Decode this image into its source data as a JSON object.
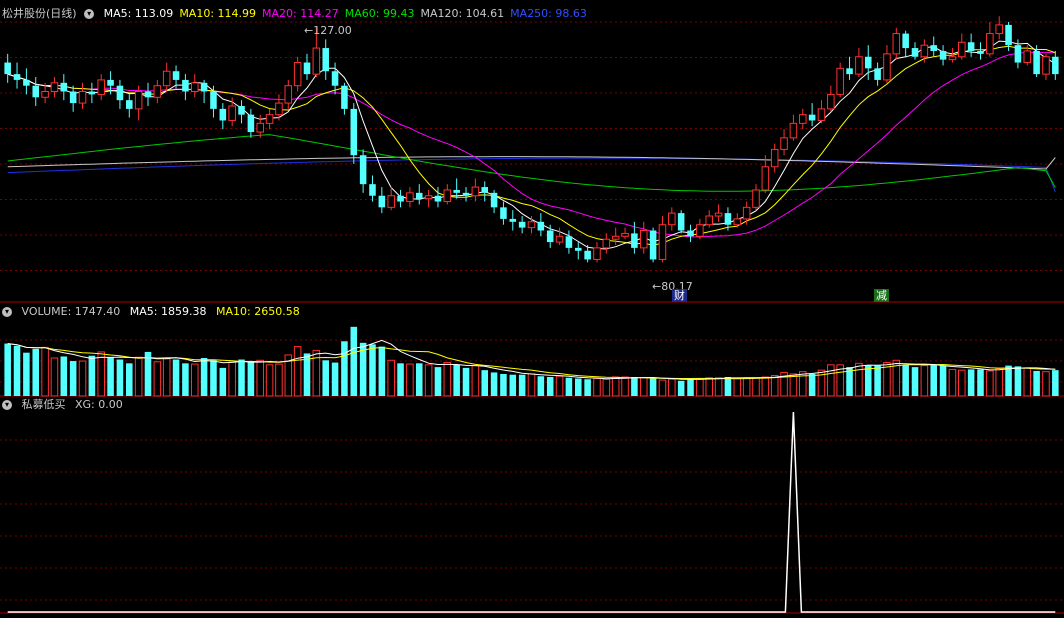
{
  "price_panel": {
    "title": "松井股份(日线)",
    "indicators": [
      {
        "label": "MA5: 113.09",
        "color": "#ffffff"
      },
      {
        "label": "MA10: 114.99",
        "color": "#ffff00"
      },
      {
        "label": "MA20: 114.27",
        "color": "#ff00ff"
      },
      {
        "label": "MA60: 99.43",
        "color": "#00e000"
      },
      {
        "label": "MA120: 104.61",
        "color": "#c8c8c8"
      },
      {
        "label": "MA250: 98.63",
        "color": "#3050ff"
      }
    ],
    "high_label": "127.00",
    "low_label": "80.17",
    "marker_cai": "财",
    "marker_jian": "减"
  },
  "volume_panel": {
    "title": "VOLUME: 1747.40",
    "ma5": "MA5: 1859.38",
    "ma10": "MA10: 2650.58",
    "ma5_color": "#ffffff",
    "ma10_color": "#ffff00"
  },
  "indicator_panel": {
    "title": "私募低买",
    "xg": "XG: 0.00"
  },
  "colors": {
    "up": "#ff3030",
    "down": "#54ffff",
    "grid": "#7a0000",
    "divider": "#b00000"
  },
  "chart_data": [
    {
      "type": "candlestick",
      "title": "松井股份(日线)",
      "ylim": [
        80,
        128
      ],
      "candles": [
        [
          121,
          119,
          122.5,
          117.5
        ],
        [
          119,
          118,
          121,
          116.5
        ],
        [
          118,
          117,
          120,
          115.5
        ],
        [
          117,
          115,
          118.5,
          113.5
        ],
        [
          115,
          116,
          117.5,
          114
        ],
        [
          116,
          117.5,
          118.5,
          115
        ],
        [
          117.5,
          116,
          119,
          114.5
        ],
        [
          116,
          114,
          117,
          112.5
        ],
        [
          114,
          116,
          117.5,
          113
        ],
        [
          116,
          115.5,
          117.5,
          114
        ],
        [
          115.5,
          118,
          119,
          114.5
        ],
        [
          118,
          117,
          119.5,
          115.5
        ],
        [
          117,
          114.5,
          118,
          113
        ],
        [
          114.5,
          113,
          115.5,
          111.5
        ],
        [
          113,
          116,
          117,
          111
        ],
        [
          116,
          115,
          117.5,
          113.5
        ],
        [
          115,
          117,
          118,
          114
        ],
        [
          117,
          119.5,
          121,
          116
        ],
        [
          119.5,
          118,
          120.5,
          116.5
        ],
        [
          118,
          116,
          119,
          114.5
        ],
        [
          116,
          117.5,
          119,
          115
        ],
        [
          117.5,
          116,
          118,
          114
        ],
        [
          116,
          113,
          117,
          111.5
        ],
        [
          113,
          111,
          114,
          109.5
        ],
        [
          111,
          113.5,
          115,
          110
        ],
        [
          113.5,
          112,
          114.5,
          110.5
        ],
        [
          112,
          109,
          113,
          108
        ],
        [
          109,
          110.5,
          112,
          108
        ],
        [
          110.5,
          112,
          113,
          109.5
        ],
        [
          112,
          114,
          115.5,
          111
        ],
        [
          114,
          117,
          118,
          113
        ],
        [
          117,
          121,
          122,
          116
        ],
        [
          121,
          119,
          122.5,
          118
        ],
        [
          119,
          123.5,
          127,
          118.5
        ],
        [
          123.5,
          119.5,
          125,
          118
        ],
        [
          119.5,
          117,
          121,
          115.5
        ],
        [
          117,
          113,
          117.5,
          112
        ],
        [
          113,
          105,
          114,
          103.5
        ],
        [
          105,
          100,
          106,
          98.5
        ],
        [
          100,
          98,
          101.5,
          97
        ],
        [
          98,
          96,
          99.5,
          95
        ],
        [
          96,
          98,
          99.5,
          95.5
        ],
        [
          98,
          97,
          99,
          96
        ],
        [
          97,
          98.5,
          99.5,
          96
        ],
        [
          98.5,
          97.5,
          100,
          96.5
        ],
        [
          97.5,
          98,
          99,
          96
        ],
        [
          98,
          97,
          99.5,
          96
        ],
        [
          97,
          99,
          100,
          96.5
        ],
        [
          99,
          98.5,
          101,
          97.5
        ],
        [
          98.5,
          98,
          99.5,
          97
        ],
        [
          98,
          99.5,
          101,
          97
        ],
        [
          99.5,
          98.5,
          100.5,
          97
        ],
        [
          98.5,
          96,
          99,
          95
        ],
        [
          96,
          94,
          97,
          93
        ],
        [
          94,
          93.5,
          95.5,
          92
        ],
        [
          93.5,
          92.5,
          94.5,
          91.5
        ],
        [
          92.5,
          93.5,
          94.5,
          91.5
        ],
        [
          93.5,
          92,
          95,
          91
        ],
        [
          92,
          90,
          93,
          89
        ],
        [
          90,
          91,
          92.5,
          89.5
        ],
        [
          91,
          89,
          92,
          88
        ],
        [
          89,
          88.5,
          90,
          87
        ],
        [
          88.5,
          87,
          89.5,
          86.5
        ],
        [
          87,
          89,
          90,
          86.5
        ],
        [
          89,
          90.5,
          91.5,
          88
        ],
        [
          90.5,
          91,
          92.5,
          89.5
        ],
        [
          91,
          91.5,
          92.5,
          90.5
        ],
        [
          91.5,
          89,
          93.5,
          88
        ],
        [
          89,
          92,
          93.5,
          88
        ],
        [
          92,
          87,
          92.5,
          86.5
        ],
        [
          87,
          93,
          94.5,
          86.5
        ],
        [
          93,
          95,
          96,
          92
        ],
        [
          95,
          92,
          95.5,
          91.5
        ],
        [
          92,
          91,
          93,
          90
        ],
        [
          91,
          93,
          94,
          90.5
        ],
        [
          93,
          94.5,
          95.5,
          92.5
        ],
        [
          94.5,
          95,
          96.5,
          93.5
        ],
        [
          95,
          93,
          96,
          92
        ],
        [
          93,
          94,
          95,
          92.5
        ],
        [
          94,
          96,
          97,
          93
        ],
        [
          96,
          99,
          100,
          95.5
        ],
        [
          99,
          103,
          105,
          98.5
        ],
        [
          103,
          106,
          107,
          102
        ],
        [
          106,
          108,
          109.5,
          105
        ],
        [
          108,
          110.5,
          112,
          107.5
        ],
        [
          110.5,
          112,
          113,
          109.5
        ],
        [
          112,
          111,
          114,
          110
        ],
        [
          111,
          113,
          114.5,
          110.5
        ],
        [
          113,
          115.5,
          117,
          112.5
        ],
        [
          115.5,
          120,
          121,
          115
        ],
        [
          120,
          119,
          122,
          118
        ],
        [
          119,
          122,
          123.5,
          118.5
        ],
        [
          122,
          120,
          124,
          118
        ],
        [
          120,
          118,
          121,
          117
        ],
        [
          118,
          122.5,
          124,
          117.5
        ],
        [
          122.5,
          126,
          127,
          121.5
        ],
        [
          126,
          123.5,
          126.5,
          122
        ],
        [
          123.5,
          122,
          124.5,
          121.5
        ],
        [
          122,
          124,
          125,
          121
        ],
        [
          124,
          123,
          125.5,
          122
        ],
        [
          123,
          121.5,
          124,
          120.5
        ],
        [
          121.5,
          122,
          123.5,
          121
        ],
        [
          122,
          124.5,
          126,
          121.5
        ],
        [
          124.5,
          123,
          126,
          122
        ],
        [
          123,
          122.5,
          124.5,
          121.5
        ],
        [
          122.5,
          126,
          128,
          122
        ],
        [
          126,
          127.5,
          129,
          125
        ],
        [
          127.5,
          124,
          128,
          123
        ],
        [
          124,
          121,
          125,
          120
        ],
        [
          121,
          123,
          124,
          120.5
        ],
        [
          123,
          119,
          124,
          118.5
        ],
        [
          119,
          122,
          122.5,
          118
        ],
        [
          122,
          119,
          123,
          118
        ]
      ],
      "ma5_last": 113.09,
      "ma10_last": 114.99,
      "ma20_last": 114.27,
      "ma60_last": 99.43,
      "ma120_last": 104.61,
      "ma250_last": 98.63
    },
    {
      "type": "bar",
      "title": "VOLUME",
      "ylim": [
        0,
        5000
      ],
      "values": [
        3450,
        3300,
        2850,
        3100,
        3200,
        2500,
        2600,
        2300,
        2300,
        2650,
        2900,
        2550,
        2400,
        2150,
        2550,
        2900,
        2250,
        2450,
        2400,
        2150,
        2100,
        2500,
        2350,
        1850,
        2250,
        2400,
        2300,
        2350,
        2050,
        2100,
        2700,
        3250,
        2800,
        3000,
        2350,
        2200,
        3600,
        4550,
        3500,
        3400,
        3250,
        2350,
        2150,
        2100,
        2150,
        2050,
        1900,
        2200,
        2050,
        1850,
        2000,
        1700,
        1550,
        1450,
        1400,
        1400,
        1450,
        1300,
        1250,
        1300,
        1200,
        1150,
        1100,
        1150,
        1100,
        1250,
        1250,
        1250,
        1200,
        1150,
        1050,
        1100,
        1000,
        1150,
        1150,
        1200,
        1200,
        1250,
        1150,
        1200,
        1200,
        1250,
        1350,
        1550,
        1450,
        1600,
        1450,
        1700,
        2050,
        2050,
        1900,
        2150,
        2000,
        2000,
        2200,
        2350,
        2050,
        1900,
        2000,
        2050,
        2000,
        1750,
        1700,
        1750,
        1750,
        1650,
        1800,
        2000,
        1950,
        1850,
        1650,
        1600,
        1700
      ],
      "ma5_last": 1859.38,
      "ma10_last": 2650.58
    },
    {
      "type": "line",
      "title": "私募低买",
      "ylim": [
        0,
        1
      ],
      "values": [
        0,
        0,
        0,
        0,
        0,
        0,
        0,
        0,
        0,
        0,
        0,
        0,
        0,
        0,
        0,
        0,
        0,
        0,
        0,
        0,
        0,
        0,
        0,
        0,
        0,
        0,
        0,
        0,
        0,
        0,
        0,
        0,
        0,
        0,
        0,
        0,
        0,
        0,
        0,
        0,
        0,
        0,
        0,
        0,
        0,
        0,
        0,
        0,
        0,
        0,
        0,
        0,
        0,
        0,
        0,
        0,
        0,
        0,
        0,
        0,
        0,
        0,
        0,
        0,
        0,
        0,
        0,
        0,
        0,
        0,
        0,
        0,
        0,
        0,
        0,
        0,
        0,
        0,
        0,
        0,
        0,
        0,
        0,
        0,
        1,
        0,
        0,
        0,
        0,
        0,
        0,
        0,
        0,
        0,
        0,
        0,
        0,
        0,
        0,
        0,
        0,
        0,
        0,
        0,
        0,
        0,
        0,
        0,
        0,
        0,
        0,
        0,
        0
      ]
    }
  ]
}
